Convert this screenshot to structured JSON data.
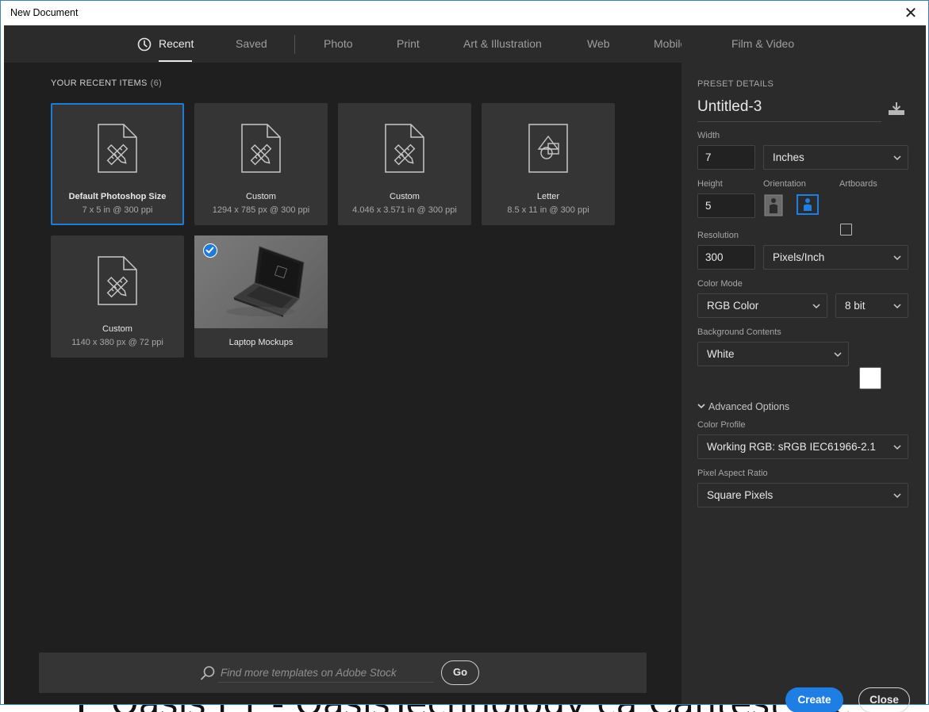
{
  "window": {
    "title": "New Document",
    "close_glyph": "✕"
  },
  "tabs": [
    {
      "label": "Recent",
      "active": true
    },
    {
      "label": "Saved"
    },
    {
      "label": "Photo"
    },
    {
      "label": "Print"
    },
    {
      "label": "Art & Illustration"
    },
    {
      "label": "Web"
    },
    {
      "label": "Mobile"
    },
    {
      "label": "Film & Video"
    }
  ],
  "recent": {
    "title": "YOUR RECENT ITEMS",
    "count": "(6)",
    "items": [
      {
        "name": "Default Photoshop Size",
        "detail": "7 x 5 in @ 300 ppi",
        "icon": "document-ruler-pencil-icon",
        "selected": true
      },
      {
        "name": "Custom",
        "detail": "1294 x 785 px @ 300 ppi",
        "icon": "document-ruler-pencil-icon"
      },
      {
        "name": "Custom",
        "detail": "4.046 x 3.571 in @ 300 ppi",
        "icon": "document-ruler-pencil-icon"
      },
      {
        "name": "Letter",
        "detail": "8.5 x 11 in @ 300 ppi",
        "icon": "document-shapes-icon"
      },
      {
        "name": "Custom",
        "detail": "1140 x 380 px @ 72 ppi",
        "icon": "document-ruler-pencil-icon"
      },
      {
        "name": "Laptop Mockups",
        "detail": "",
        "icon": "laptop-mockup-thumbnail",
        "checked": true
      }
    ]
  },
  "search": {
    "placeholder": "Find more templates on Adobe Stock",
    "go_label": "Go"
  },
  "preset": {
    "header": "PRESET DETAILS",
    "name": "Untitled-3",
    "width_label": "Width",
    "width_value": "7",
    "width_unit": "Inches",
    "height_label": "Height",
    "height_value": "5",
    "orientation_label": "Orientation",
    "artboards_label": "Artboards",
    "resolution_label": "Resolution",
    "resolution_value": "300",
    "resolution_unit": "Pixels/Inch",
    "color_mode_label": "Color Mode",
    "color_mode": "RGB Color",
    "bit_depth": "8 bit",
    "background_label": "Background Contents",
    "background": "White",
    "advanced_label": "Advanced Options",
    "color_profile_label": "Color Profile",
    "color_profile": "Working RGB: sRGB IEC61966-2.1",
    "pixel_aspect_label": "Pixel Aspect Ratio",
    "pixel_aspect": "Square Pixels"
  },
  "actions": {
    "create": "Create",
    "close": "Close"
  },
  "background_doc": {
    "line": "Oasis ET - OasisTechnology ca Cantest Tec",
    "edge_c": "C",
    "edge_e": "e"
  },
  "colors": {
    "accent": "#1e7ee4",
    "selected_border": "#1e7bd8",
    "dialog_bg": "#1f1f1f",
    "panel_bg": "#2b2b2b"
  }
}
